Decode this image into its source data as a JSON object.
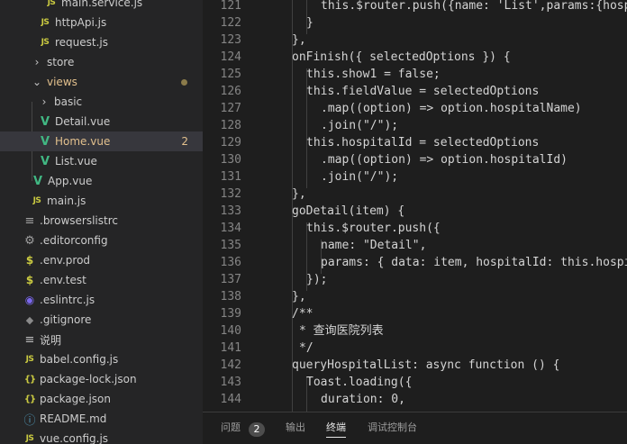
{
  "explorer": {
    "items": [
      {
        "label": "main.service.js",
        "icon": "js-file-icon",
        "glyph": "JS"
      },
      {
        "label": "httpApi.js",
        "icon": "js-file-icon",
        "glyph": "JS"
      },
      {
        "label": "request.js",
        "icon": "js-file-icon",
        "glyph": "JS"
      },
      {
        "label": "store",
        "icon": "chevron-right-icon",
        "glyph": "›"
      },
      {
        "label": "views",
        "icon": "chevron-down-icon",
        "glyph": "⌄"
      },
      {
        "label": "basic",
        "icon": "chevron-right-icon",
        "glyph": "›"
      },
      {
        "label": "Detail.vue",
        "icon": "vue-file-icon",
        "glyph": "V"
      },
      {
        "label": "Home.vue",
        "icon": "vue-file-icon",
        "glyph": "V",
        "badge": "2"
      },
      {
        "label": "List.vue",
        "icon": "vue-file-icon",
        "glyph": "V"
      },
      {
        "label": "App.vue",
        "icon": "vue-file-icon",
        "glyph": "V"
      },
      {
        "label": "main.js",
        "icon": "js-file-icon",
        "glyph": "JS"
      },
      {
        "label": ".browserslistrc",
        "icon": "config-file-icon",
        "glyph": "≡"
      },
      {
        "label": ".editorconfig",
        "icon": "gear-icon",
        "glyph": "⚙"
      },
      {
        "label": ".env.prod",
        "icon": "env-file-icon",
        "glyph": "$"
      },
      {
        "label": ".env.test",
        "icon": "env-file-icon",
        "glyph": "$"
      },
      {
        "label": ".eslintrc.js",
        "icon": "eslint-icon",
        "glyph": "◉"
      },
      {
        "label": ".gitignore",
        "icon": "git-icon",
        "glyph": "◆"
      },
      {
        "label": "说明",
        "icon": "text-file-icon",
        "glyph": "≡"
      },
      {
        "label": "babel.config.js",
        "icon": "js-file-icon",
        "glyph": "JS"
      },
      {
        "label": "package-lock.json",
        "icon": "json-file-icon",
        "glyph": "{}"
      },
      {
        "label": "package.json",
        "icon": "json-file-icon",
        "glyph": "{}"
      },
      {
        "label": "README.md",
        "icon": "info-icon",
        "glyph": "ⓘ"
      },
      {
        "label": "vue.config.js",
        "icon": "js-file-icon",
        "glyph": "JS"
      }
    ]
  },
  "editor": {
    "lines": [
      {
        "n": "121",
        "code": "        this.$router.push({name: 'List',params:{hospitalId}})"
      },
      {
        "n": "122",
        "code": "      }"
      },
      {
        "n": "123",
        "code": "    },"
      },
      {
        "n": "124",
        "code": "    onFinish({ selectedOptions }) {"
      },
      {
        "n": "125",
        "code": "      this.show1 = false;"
      },
      {
        "n": "126",
        "code": "      this.fieldValue = selectedOptions"
      },
      {
        "n": "127",
        "code": "        .map((option) => option.hospitalName)"
      },
      {
        "n": "128",
        "code": "        .join(\"/\");"
      },
      {
        "n": "129",
        "code": "      this.hospitalId = selectedOptions"
      },
      {
        "n": "130",
        "code": "        .map((option) => option.hospitalId)"
      },
      {
        "n": "131",
        "code": "        .join(\"/\");"
      },
      {
        "n": "132",
        "code": "    },"
      },
      {
        "n": "133",
        "code": "    goDetail(item) {"
      },
      {
        "n": "134",
        "code": "      this.$router.push({"
      },
      {
        "n": "135",
        "code": "        name: \"Detail\","
      },
      {
        "n": "136",
        "code": "        params: { data: item, hospitalId: this.hospitalId },"
      },
      {
        "n": "137",
        "code": "      });"
      },
      {
        "n": "138",
        "code": "    },"
      },
      {
        "n": "139",
        "code": "    /**"
      },
      {
        "n": "140",
        "code": "     * 查询医院列表"
      },
      {
        "n": "141",
        "code": "     */"
      },
      {
        "n": "142",
        "code": "    queryHospitalList: async function () {"
      },
      {
        "n": "143",
        "code": "      Toast.loading({"
      },
      {
        "n": "144",
        "code": "        duration: 0,"
      }
    ]
  },
  "panel": {
    "tabs": [
      {
        "label": "问题",
        "count": "2"
      },
      {
        "label": "输出"
      },
      {
        "label": "终端",
        "active": true
      },
      {
        "label": "调试控制台"
      }
    ]
  }
}
